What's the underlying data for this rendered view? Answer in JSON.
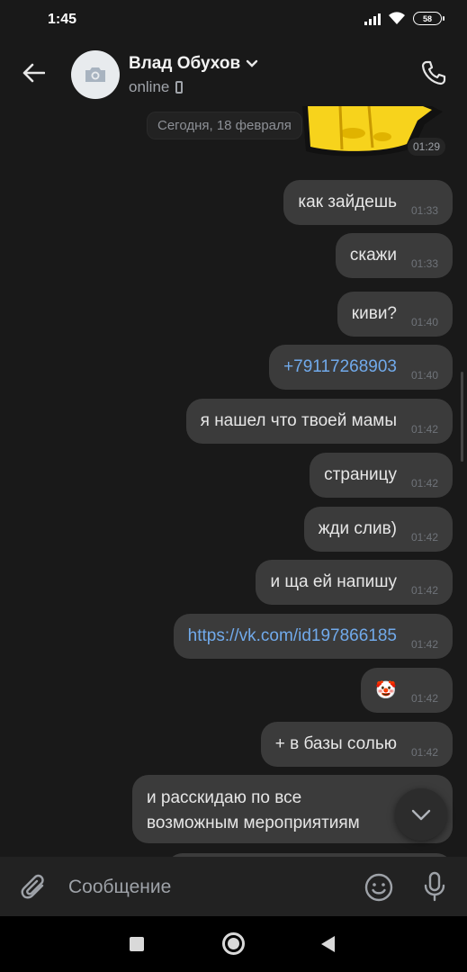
{
  "status_bar": {
    "time": "1:45",
    "battery": "58"
  },
  "header": {
    "contact_name": "Влад Обухов",
    "status": "online"
  },
  "chat": {
    "sticker_time": "01:29",
    "date_divider": "Сегодня, 18 февраля",
    "messages": [
      {
        "text": "как зайдешь",
        "time": "01:33",
        "type": "text"
      },
      {
        "text": "скажи",
        "time": "01:33",
        "type": "text"
      },
      {
        "text": "киви?",
        "time": "01:40",
        "type": "text"
      },
      {
        "text": "+79117268903",
        "time": "01:40",
        "type": "link"
      },
      {
        "text": "я нашел что твоей мамы",
        "time": "01:42",
        "type": "text"
      },
      {
        "text": "страницу",
        "time": "01:42",
        "type": "text"
      },
      {
        "text": "жди слив)",
        "time": "01:42",
        "type": "text"
      },
      {
        "text": "и ща ей напишу",
        "time": "01:42",
        "type": "text"
      },
      {
        "text": "https://vk.com/id197866185",
        "time": "01:42",
        "type": "link"
      },
      {
        "text": "🤡",
        "time": "01:42",
        "type": "emoji"
      },
      {
        "text": "+ в базы солью",
        "time": "01:42",
        "type": "text"
      },
      {
        "text": "и расскидаю по все возможным мероприятиям",
        "time": "",
        "type": "text"
      }
    ]
  },
  "composer": {
    "placeholder": "Сообщение"
  },
  "colors": {
    "bubble": "#3b3b3b",
    "link": "#71aaeb",
    "background": "#191919"
  }
}
